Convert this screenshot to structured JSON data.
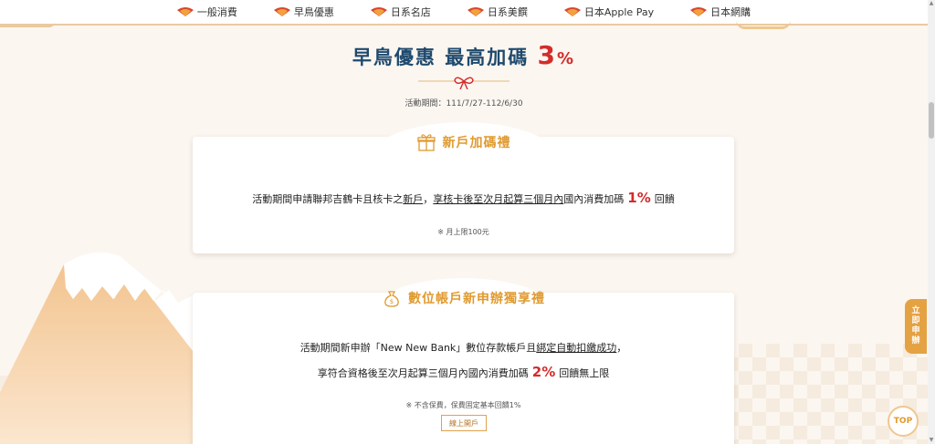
{
  "nav": {
    "items": [
      {
        "label": "一般消費",
        "icon": "fan-icon"
      },
      {
        "label": "早鳥優惠",
        "icon": "fan-icon"
      },
      {
        "label": "日系名店",
        "icon": "fan-icon"
      },
      {
        "label": "日系美饌",
        "icon": "fan-icon"
      },
      {
        "label": "日本Apple Pay",
        "icon": "fan-icon"
      },
      {
        "label": "日本網購",
        "icon": "fan-icon"
      }
    ]
  },
  "hero": {
    "title": "早鳥優惠 最高加碼",
    "pct_number": "3",
    "pct_sign": "%",
    "period": "活動期間：111/7/27-112/6/30"
  },
  "card1": {
    "tab_title": "新戶加碼禮",
    "tab_icon": "gift-icon",
    "text_pre": "活動期間申請聯邦吉鶴卡且核卡之",
    "text_u1": "新戶",
    "text_sep": "，",
    "text_u2": "享核卡後至次月起算三個月內",
    "text_mid": "國內消費加碼",
    "highlight": "1%",
    "text_post": "回饋",
    "note": "※ 月上限100元"
  },
  "card2": {
    "tab_title": "數位帳戶新申辦獨享禮",
    "tab_icon": "money-bag-icon",
    "line1_pre": "活動期間新申辦「New New Bank」數位存款帳戶且",
    "line1_u": "綁定自動扣繳成功",
    "line1_post": "，",
    "line2_pre": "享符合資格後至次月起算三個月內國內消費加碼",
    "highlight": "2%",
    "line2_post": "回饋無上限",
    "note": "※ 不含保費，保費固定基本回饋1%",
    "button_label": "線上開戶"
  },
  "side": {
    "apply_label": [
      "立",
      "即",
      "申",
      "辦"
    ],
    "top_label": "TOP"
  },
  "colors": {
    "accent": "#e09a2f",
    "highlight": "#d42b2b",
    "title": "#1f4a6e",
    "background": "#fbf6f0"
  }
}
